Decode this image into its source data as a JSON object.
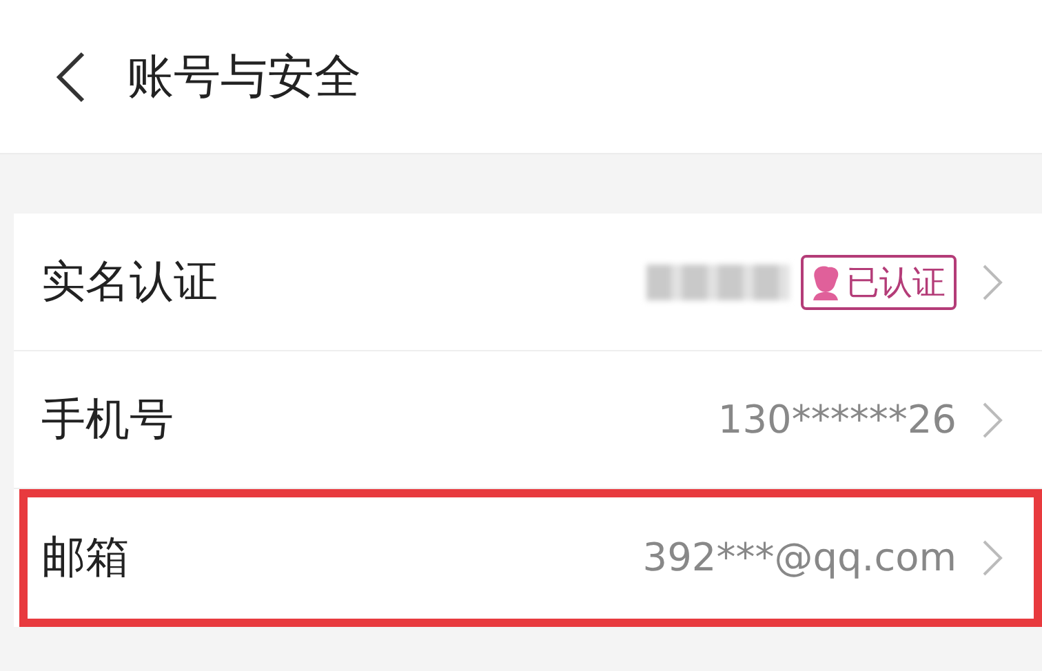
{
  "header": {
    "title": "账号与安全"
  },
  "rows": [
    {
      "label": "实名认证",
      "kind": "verified",
      "redacted": true,
      "badge": "已认证",
      "highlighted": false
    },
    {
      "label": "手机号",
      "kind": "text",
      "value": "130******26",
      "highlighted": false
    },
    {
      "label": "邮箱",
      "kind": "text",
      "value": "392***@qq.com",
      "highlighted": true
    }
  ]
}
